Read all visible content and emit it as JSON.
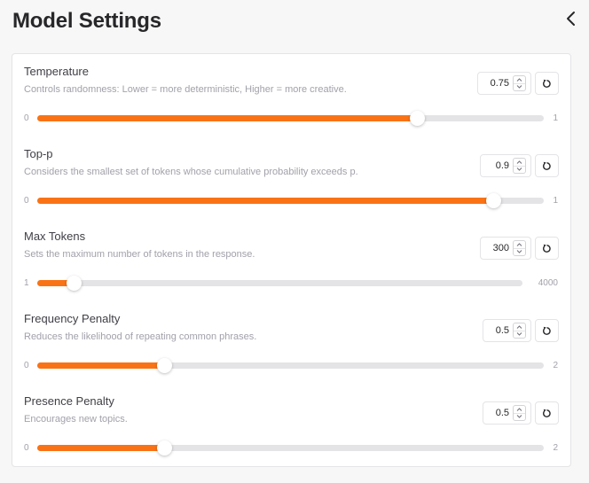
{
  "header": {
    "title": "Model Settings",
    "collapse_icon": "chevron-left-icon"
  },
  "colors": {
    "accent": "#f97316",
    "track": "#e4e4e7",
    "panel_bg": "#ffffff",
    "page_bg": "#f7f7f7"
  },
  "settings": [
    {
      "label": "Temperature",
      "description": "Controls randomness: Lower = more deterministic, Higher = more creative.",
      "value": "0.75",
      "min_label": "0",
      "max_label": "1",
      "fraction": 0.75
    },
    {
      "label": "Top-p",
      "description": "Considers the smallest set of tokens whose cumulative probability exceeds p.",
      "value": "0.9",
      "min_label": "0",
      "max_label": "1",
      "fraction": 0.9
    },
    {
      "label": "Max Tokens",
      "description": "Sets the maximum number of tokens in the response.",
      "value": "300",
      "min_label": "1",
      "max_label": "4000",
      "fraction": 0.075
    },
    {
      "label": "Frequency Penalty",
      "description": "Reduces the likelihood of repeating common phrases.",
      "value": "0.5",
      "min_label": "0",
      "max_label": "2",
      "fraction": 0.25
    },
    {
      "label": "Presence Penalty",
      "description": "Encourages new topics.",
      "value": "0.5",
      "min_label": "0",
      "max_label": "2",
      "fraction": 0.25
    }
  ]
}
